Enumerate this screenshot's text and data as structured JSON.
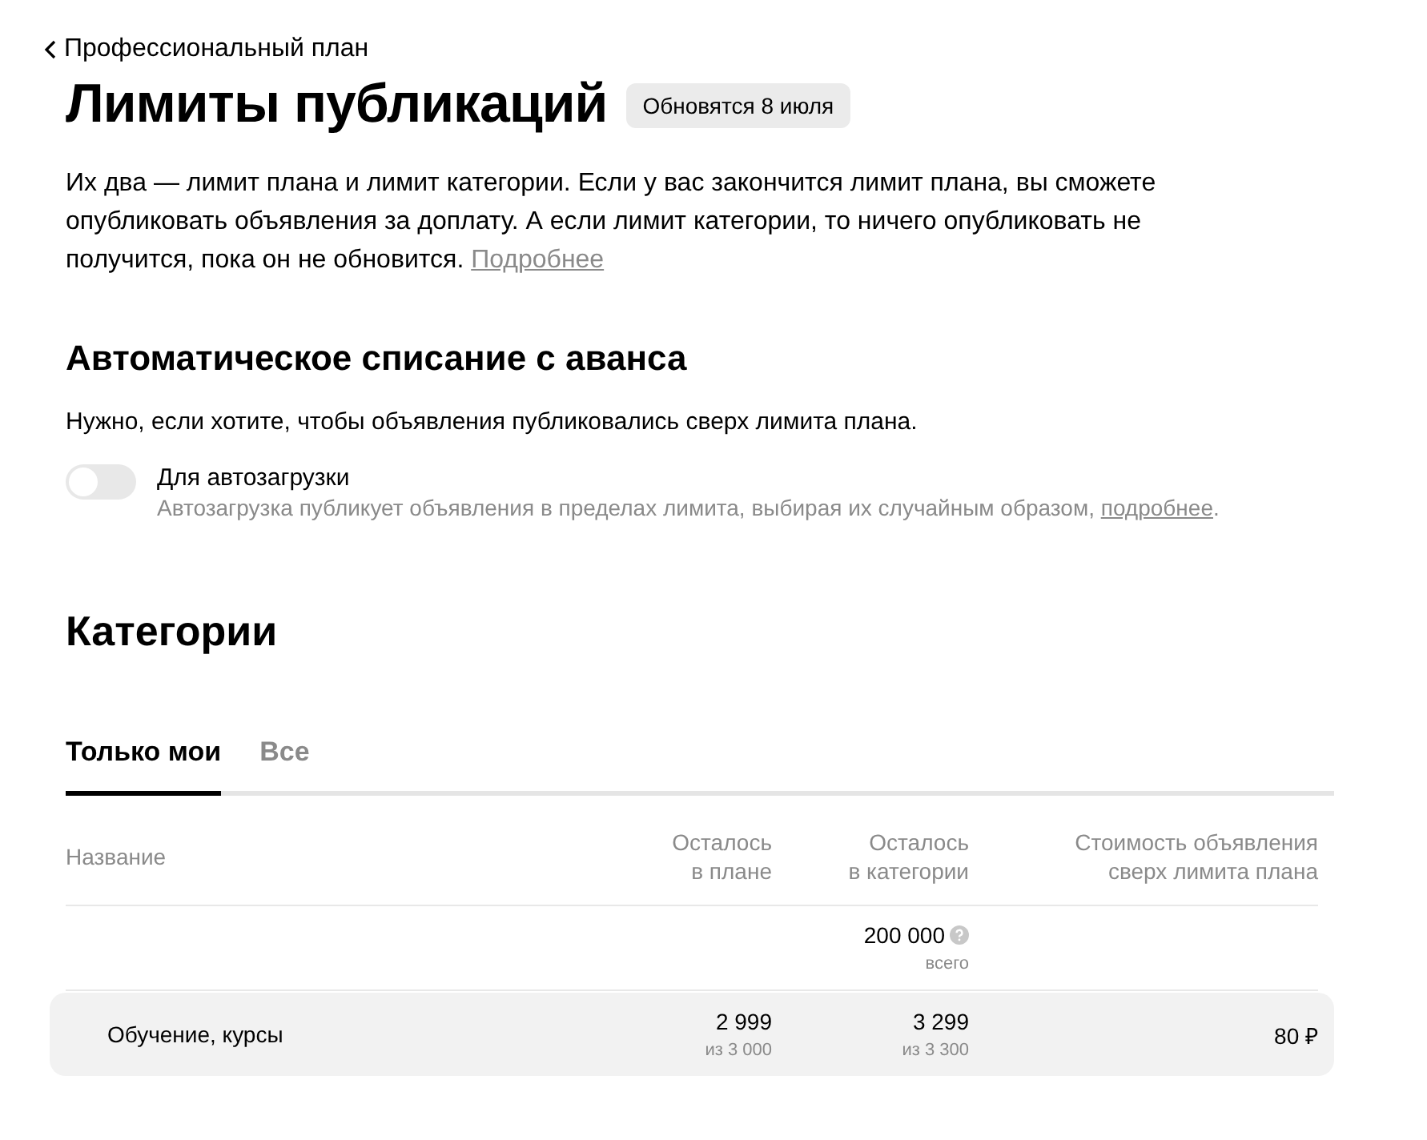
{
  "back_link": {
    "label": "Профессиональный план"
  },
  "header": {
    "title": "Лимиты публикаций",
    "badge": "Обновятся 8 июля"
  },
  "intro": {
    "text": "Их два — лимит плана и лимит категории. Если у вас закончится лимит плана, вы сможете опубликовать объявления за доплату. А если лимит категории, то ничего опубликовать не получится, пока он не обновится.",
    "link": "Подробнее"
  },
  "auto_debit": {
    "title": "Автоматическое списание с аванса",
    "description": "Нужно, если хотите, чтобы объявления публиковались сверх лимита плана.",
    "toggle": {
      "label": "Для автозагрузки",
      "on": false,
      "hint": "Автозагрузка публикует объявления в пределах лимита, выбирая их случайным образом,",
      "hint_link": "подробнее",
      "hint_end": "."
    }
  },
  "categories": {
    "title": "Категории",
    "tabs": [
      {
        "label": "Только мои",
        "selected": true
      },
      {
        "label": "Все",
        "selected": false
      }
    ],
    "table": {
      "columns": [
        "Название",
        "Осталось\nв плане",
        "Осталось\nв категории",
        "Стоимость объявления\nсверх лимита плана"
      ],
      "total": {
        "value": "200 000",
        "caption": "всего"
      },
      "rows": [
        {
          "name": "Обучение, курсы",
          "plan_left": "2 999",
          "plan_of": "из 3 000",
          "category_left": "3 299",
          "category_of": "из 3 300",
          "price": "80 ₽"
        }
      ]
    }
  }
}
